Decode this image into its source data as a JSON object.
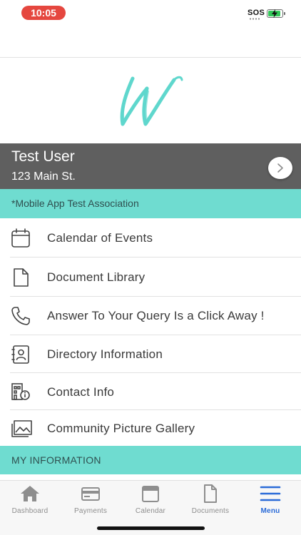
{
  "status_bar": {
    "time": "10:05",
    "carrier": "SOS",
    "battery_level": 0.85,
    "battery_color": "#34c759",
    "time_pill_color": "#e5473f"
  },
  "logo": {
    "icon": "cursive-w-logo",
    "color": "#5fd7cd"
  },
  "user": {
    "name": "Test User",
    "address": "123 Main St.",
    "action_icon": "chevron-right-icon"
  },
  "association": {
    "label": "*Mobile App Test Association"
  },
  "menu": {
    "items": [
      {
        "label": "Calendar of Events",
        "icon": "calendar-icon"
      },
      {
        "label": "Document Library",
        "icon": "document-icon"
      },
      {
        "label": "Answer To Your Query Is a Click Away !",
        "icon": "phone-icon"
      },
      {
        "label": "Directory Information",
        "icon": "contact-book-icon"
      },
      {
        "label": "Contact Info",
        "icon": "building-info-icon"
      },
      {
        "label": "Community Picture Gallery",
        "icon": "gallery-icon"
      }
    ]
  },
  "my_information": {
    "label": "MY INFORMATION"
  },
  "tab_bar": {
    "tabs": [
      {
        "label": "Dashboard",
        "icon": "home-icon"
      },
      {
        "label": "Payments",
        "icon": "credit-card-icon"
      },
      {
        "label": "Calendar",
        "icon": "calendar-icon"
      },
      {
        "label": "Documents",
        "icon": "document-icon"
      },
      {
        "label": "Menu",
        "icon": "hamburger-menu-icon"
      }
    ],
    "active": "Menu",
    "active_color": "#2a6bd8",
    "inactive_color": "#8e8e8e"
  },
  "colors": {
    "accent": "#6fdcd0",
    "banner": "#5f5f5f"
  }
}
